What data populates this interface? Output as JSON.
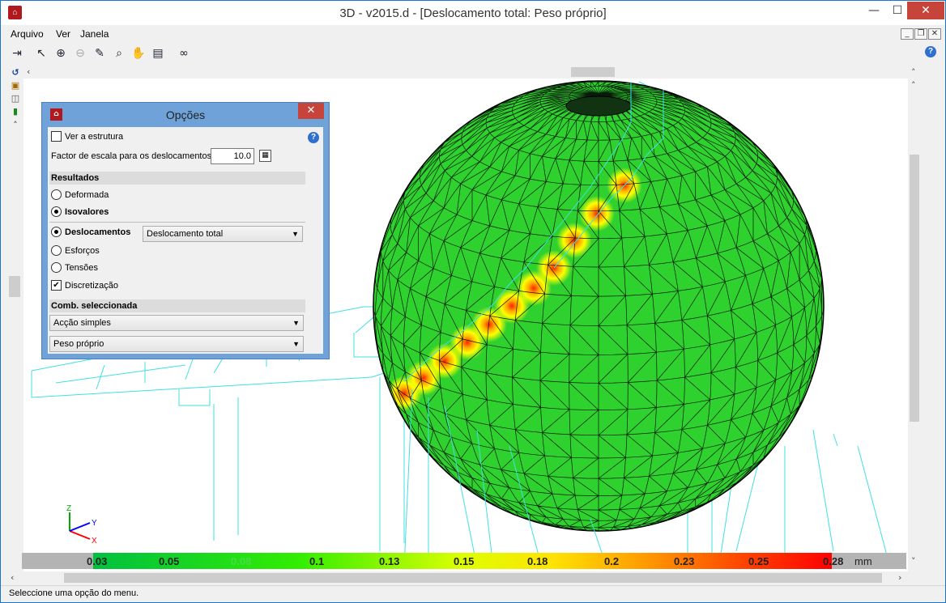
{
  "window": {
    "title": "3D - v2015.d - [Deslocamento total: Peso próprio]",
    "minimize_glyph": "—",
    "maximize_glyph": "☐",
    "close_glyph": "✕"
  },
  "menu": {
    "items": [
      "Arquivo",
      "Ver",
      "Janela"
    ]
  },
  "mdi_controls": {
    "minimize_glyph": "_",
    "restore_glyph": "❐",
    "close_glyph": "✕"
  },
  "toolbar": {
    "icons": [
      "exit-icon",
      "select-icon",
      "zoom-window-icon",
      "zoom-out-icon",
      "edit-icon",
      "zoom-icon",
      "pan-hand-icon",
      "print-icon",
      "binoculars-icon"
    ],
    "help_glyph": "?"
  },
  "left_tools": {
    "icons": [
      "rotate-icon",
      "cube-icon",
      "cube-stack-icon",
      "column-icon"
    ]
  },
  "dialog": {
    "title": "Opções",
    "close_glyph": "✕",
    "help_glyph": "?",
    "show_structure_label": "Ver a estrutura",
    "show_structure_checked": false,
    "scale_factor_label": "Factor de escala para os deslocamentos",
    "scale_factor_value": "10.0",
    "results_section": "Resultados",
    "deformed_label": "Deformada",
    "isovalues_label": "Isovalores",
    "displacements_label": "Deslocamentos",
    "displacement_type_value": "Deslocamento total",
    "forces_label": "Esforços",
    "stresses_label": "Tensões",
    "discretization_label": "Discretização",
    "discretization_checked": true,
    "combination_section": "Comb. seleccionada",
    "combination_type_value": "Acção simples",
    "load_case_value": "Peso próprio",
    "selected_result_mode": "isovalores",
    "selected_result_kind": "deslocamentos"
  },
  "legend": {
    "values": [
      "0.03",
      "0.05",
      "0.08",
      "0.1",
      "0.13",
      "0.15",
      "0.18",
      "0.2",
      "0.23",
      "0.25",
      "0.28"
    ],
    "unit": "mm",
    "colors": [
      "#00c040",
      "#22dd22",
      "#66ee00",
      "#aaff00",
      "#ddff00",
      "#ffee00",
      "#ffcc00",
      "#ff9900",
      "#ff6600",
      "#ff3300",
      "#ff0000"
    ]
  },
  "axes": {
    "x": "X",
    "y": "Y",
    "z": "Z"
  },
  "colors": {
    "sphere_fill": "#2fd12f",
    "mesh_line": "#0a1a0a",
    "structure_line": "#40e0e0",
    "hotspot": "#ffee00"
  },
  "status": {
    "text": "Seleccione uma opção do menu."
  }
}
